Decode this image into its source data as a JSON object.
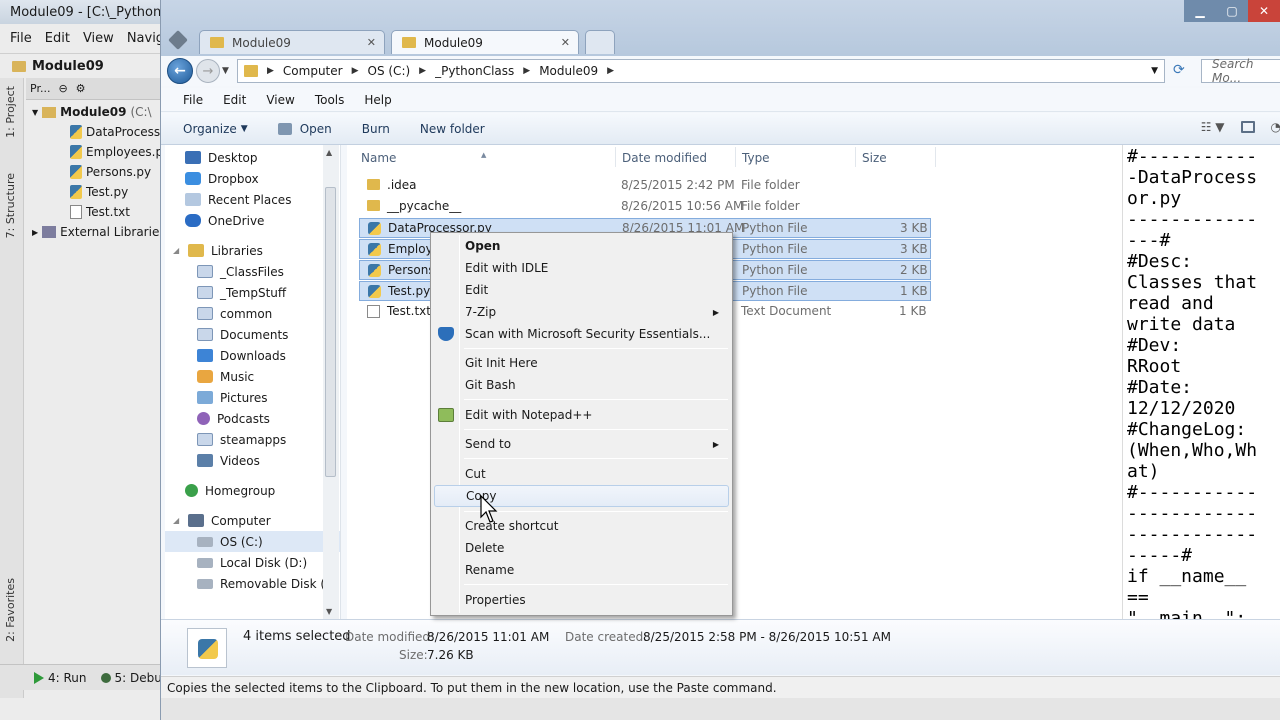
{
  "ide": {
    "title": "Module09 - [C:\\_PythonC",
    "menu": [
      "File",
      "Edit",
      "View",
      "Navigate"
    ],
    "breadcrumb": "Module09",
    "panel_label": "Pr...",
    "tree_root": "Module09",
    "tree_root_path": "(C:\\",
    "tree_files": [
      {
        "name": "DataProcessor.py",
        "kind": "py"
      },
      {
        "name": "Employees.py",
        "kind": "py"
      },
      {
        "name": "Persons.py",
        "kind": "py"
      },
      {
        "name": "Test.py",
        "kind": "py"
      },
      {
        "name": "Test.txt",
        "kind": "txt"
      }
    ],
    "external": "External Libraries",
    "side_tabs": {
      "project": "1: Project",
      "structure": "7: Structure",
      "favorites": "2: Favorites"
    },
    "bottom": {
      "run": "4: Run",
      "debug": "5: Debu"
    }
  },
  "explorer": {
    "tabs": [
      {
        "label": "Module09",
        "active": false
      },
      {
        "label": "Module09",
        "active": true
      }
    ],
    "tab_close": "✕",
    "address": [
      "Computer",
      "OS (C:)",
      "_PythonClass",
      "Module09"
    ],
    "search_placeholder": "Search Mo...",
    "menu": [
      "File",
      "Edit",
      "View",
      "Tools",
      "Help"
    ],
    "commands": {
      "organize": "Organize",
      "open": "Open",
      "burn": "Burn",
      "new_folder": "New folder"
    },
    "nav": {
      "favorites": [
        "Desktop",
        "Dropbox",
        "Recent Places",
        "OneDrive"
      ],
      "libraries_header": "Libraries",
      "libraries": [
        "_ClassFiles",
        "_TempStuff",
        "common",
        "Documents",
        "Downloads",
        "Music",
        "Pictures",
        "Podcasts",
        "steamapps",
        "Videos"
      ],
      "homegroup": "Homegroup",
      "computer_header": "Computer",
      "drives": [
        "OS (C:)",
        "Local Disk (D:)",
        "Removable Disk (F:)"
      ]
    },
    "columns": {
      "name": "Name",
      "date": "Date modified",
      "type": "Type",
      "size": "Size"
    },
    "files": [
      {
        "name": ".idea",
        "date": "8/25/2015 2:42 PM",
        "type": "File folder",
        "size": "",
        "kind": "folder",
        "selected": false
      },
      {
        "name": "__pycache__",
        "date": "8/26/2015 10:56 AM",
        "type": "File folder",
        "size": "",
        "kind": "folder",
        "selected": false
      },
      {
        "name": "DataProcessor.py",
        "date": "8/26/2015 11:01 AM",
        "type": "Python File",
        "size": "3 KB",
        "kind": "py",
        "selected": true
      },
      {
        "name": "Employees.py",
        "date": "",
        "type": "Python File",
        "size": "3 KB",
        "kind": "py",
        "selected": true
      },
      {
        "name": "Persons.py",
        "date": "",
        "type": "Python File",
        "size": "2 KB",
        "kind": "py",
        "selected": true
      },
      {
        "name": "Test.py",
        "date": "",
        "type": "Python File",
        "size": "1 KB",
        "kind": "py",
        "selected": true
      },
      {
        "name": "Test.txt",
        "date": "",
        "type": "Text Document",
        "size": "1 KB",
        "kind": "txt",
        "selected": false
      }
    ],
    "truncated_names": {
      "employees": "Employee",
      "persons": "Persons.p"
    },
    "context_menu": [
      {
        "label": "Open",
        "bold": true
      },
      {
        "label": "Edit with IDLE"
      },
      {
        "label": "Edit"
      },
      {
        "label": "7-Zip",
        "submenu": true
      },
      {
        "label": "Scan with Microsoft Security Essentials...",
        "icon": "shield-icon"
      },
      {
        "label": "Git Init Here"
      },
      {
        "label": "Git Bash"
      },
      {
        "label": "Edit with Notepad++",
        "icon": "notepad-icon"
      },
      {
        "label": "Send to",
        "submenu": true
      },
      {
        "label": "Cut"
      },
      {
        "label": "Copy",
        "hover": true
      },
      {
        "label": "Create shortcut"
      },
      {
        "label": "Delete"
      },
      {
        "label": "Rename"
      },
      {
        "label": "Properties"
      }
    ],
    "details": {
      "selected": "4 items selected",
      "modified_label": "Date modified:",
      "modified": "8/26/2015 11:01 AM",
      "created_label": "Date created:",
      "created": "8/25/2015 2:58 PM - 8/26/2015 10:51 AM",
      "size_label": "Size:",
      "size": "7.26 KB"
    },
    "status": "Copies the selected items to the Clipboard. To put them in the new location, use the Paste command."
  },
  "editor": {
    "lines": [
      "#-----------",
      "-DataProcess",
      "or.py",
      "------------",
      "---#",
      "#Desc:",
      "Classes that",
      "read and",
      "write data",
      "#Dev:",
      "RRoot",
      "#Date:",
      "12/12/2020",
      "#ChangeLog:",
      "(When,Who,Wh",
      "at)",
      "#-----------",
      "------------",
      "------------",
      "-----#",
      "if __name__",
      "==",
      "\"__main__\":"
    ]
  },
  "colors": {
    "selection": "#cfe0f5",
    "accent": "#1e5a98"
  }
}
